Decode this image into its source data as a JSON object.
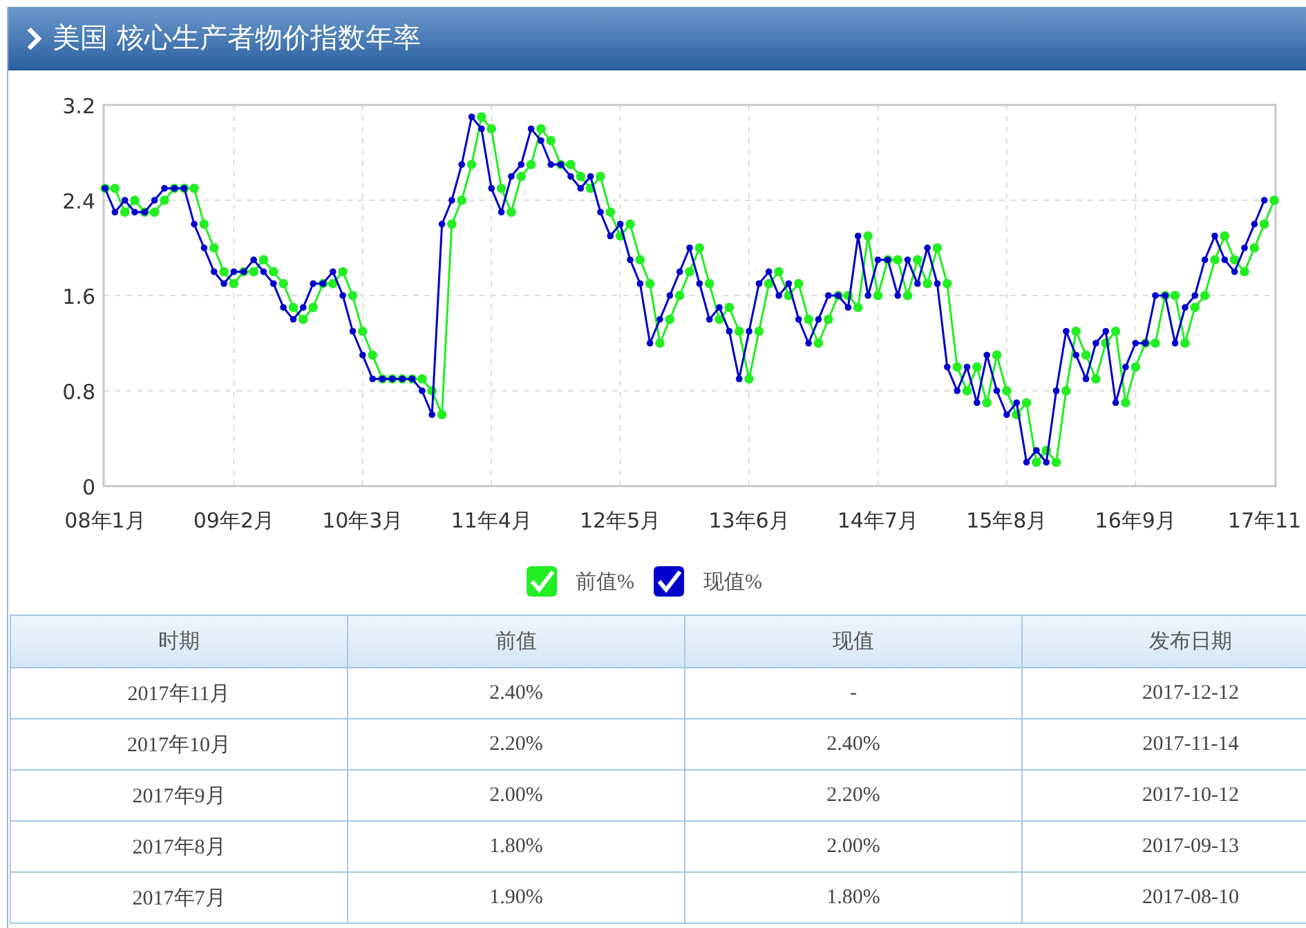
{
  "header": {
    "title": "美国 核心生产者物价指数年率"
  },
  "chart": {
    "chart_data": {
      "type": "line",
      "ylim": [
        0,
        3.2
      ],
      "yticks": [
        0,
        0.8,
        1.6,
        2.4,
        3.2
      ],
      "grid": true,
      "categories": [
        "08年1月",
        null,
        null,
        null,
        null,
        null,
        null,
        null,
        null,
        null,
        null,
        null,
        null,
        "09年2月",
        null,
        null,
        null,
        null,
        null,
        null,
        null,
        null,
        null,
        null,
        null,
        null,
        "10年3月",
        null,
        null,
        null,
        null,
        null,
        null,
        null,
        null,
        null,
        null,
        null,
        null,
        "11年4月",
        null,
        null,
        null,
        null,
        null,
        null,
        null,
        null,
        null,
        null,
        null,
        null,
        "12年5月",
        null,
        null,
        null,
        null,
        null,
        null,
        null,
        null,
        null,
        null,
        null,
        null,
        "13年6月",
        null,
        null,
        null,
        null,
        null,
        null,
        null,
        null,
        null,
        null,
        null,
        null,
        "14年7月",
        null,
        null,
        null,
        null,
        null,
        null,
        null,
        null,
        null,
        null,
        null,
        null,
        "15年8月",
        null,
        null,
        null,
        null,
        null,
        null,
        null,
        null,
        null,
        null,
        null,
        null,
        "16年9月",
        null,
        null,
        null,
        null,
        null,
        null,
        null,
        null,
        null,
        null,
        null,
        null,
        null,
        "17年11"
      ],
      "series": [
        {
          "name": "前值%",
          "color": "#22ee22",
          "marker": "circle",
          "values": [
            2.5,
            2.5,
            2.3,
            2.4,
            2.3,
            2.3,
            2.4,
            2.5,
            2.5,
            2.5,
            2.2,
            2.0,
            1.8,
            1.7,
            1.8,
            1.8,
            1.9,
            1.8,
            1.7,
            1.5,
            1.4,
            1.5,
            1.7,
            1.7,
            1.8,
            1.6,
            1.3,
            1.1,
            0.9,
            0.9,
            0.9,
            0.9,
            0.9,
            0.8,
            0.6,
            2.2,
            2.4,
            2.7,
            3.1,
            3.0,
            2.5,
            2.3,
            2.6,
            2.7,
            3.0,
            2.9,
            2.7,
            2.7,
            2.6,
            2.5,
            2.6,
            2.3,
            2.1,
            2.2,
            1.9,
            1.7,
            1.2,
            1.4,
            1.6,
            1.8,
            2.0,
            1.7,
            1.4,
            1.5,
            1.3,
            0.9,
            1.3,
            1.7,
            1.8,
            1.6,
            1.7,
            1.4,
            1.2,
            1.4,
            1.6,
            1.6,
            1.5,
            2.1,
            1.6,
            1.9,
            1.9,
            1.6,
            1.9,
            1.7,
            2.0,
            1.7,
            1.0,
            0.8,
            1.0,
            0.7,
            1.1,
            0.8,
            0.6,
            0.7,
            0.2,
            0.3,
            0.2,
            0.8,
            1.3,
            1.1,
            0.9,
            1.2,
            1.3,
            0.7,
            1.0,
            1.2,
            1.2,
            1.6,
            1.6,
            1.2,
            1.5,
            1.6,
            1.9,
            2.1,
            1.9,
            1.8,
            2.0,
            2.2,
            2.4
          ]
        },
        {
          "name": "现值%",
          "color": "#0000cc",
          "marker": "circle",
          "values": [
            2.5,
            2.3,
            2.4,
            2.3,
            2.3,
            2.4,
            2.5,
            2.5,
            2.5,
            2.2,
            2.0,
            1.8,
            1.7,
            1.8,
            1.8,
            1.9,
            1.8,
            1.7,
            1.5,
            1.4,
            1.5,
            1.7,
            1.7,
            1.8,
            1.6,
            1.3,
            1.1,
            0.9,
            0.9,
            0.9,
            0.9,
            0.9,
            0.8,
            0.6,
            2.2,
            2.4,
            2.7,
            3.1,
            3.0,
            2.5,
            2.3,
            2.6,
            2.7,
            3.0,
            2.9,
            2.7,
            2.7,
            2.6,
            2.5,
            2.6,
            2.3,
            2.1,
            2.2,
            1.9,
            1.7,
            1.2,
            1.4,
            1.6,
            1.8,
            2.0,
            1.7,
            1.4,
            1.5,
            1.3,
            0.9,
            1.3,
            1.7,
            1.8,
            1.6,
            1.7,
            1.4,
            1.2,
            1.4,
            1.6,
            1.6,
            1.5,
            2.1,
            1.6,
            1.9,
            1.9,
            1.6,
            1.9,
            1.7,
            2.0,
            1.7,
            1.0,
            0.8,
            1.0,
            0.7,
            1.1,
            0.8,
            0.6,
            0.7,
            0.2,
            0.3,
            0.2,
            0.8,
            1.3,
            1.1,
            0.9,
            1.2,
            1.3,
            0.7,
            1.0,
            1.2,
            1.2,
            1.6,
            1.6,
            1.2,
            1.5,
            1.6,
            1.9,
            2.1,
            1.9,
            1.8,
            2.0,
            2.2,
            2.4,
            null
          ]
        }
      ]
    },
    "legend": [
      {
        "checked": true
      },
      {
        "checked": true
      }
    ]
  },
  "table": {
    "columns": [
      "时期",
      "前值",
      "现值",
      "发布日期"
    ],
    "rows": [
      [
        "2017年11月",
        "2.40%",
        "-",
        "2017-12-12"
      ],
      [
        "2017年10月",
        "2.20%",
        "2.40%",
        "2017-11-14"
      ],
      [
        "2017年9月",
        "2.00%",
        "2.20%",
        "2017-10-12"
      ],
      [
        "2017年8月",
        "1.80%",
        "2.00%",
        "2017-09-13"
      ],
      [
        "2017年7月",
        "1.90%",
        "1.80%",
        "2017-08-10"
      ]
    ]
  }
}
